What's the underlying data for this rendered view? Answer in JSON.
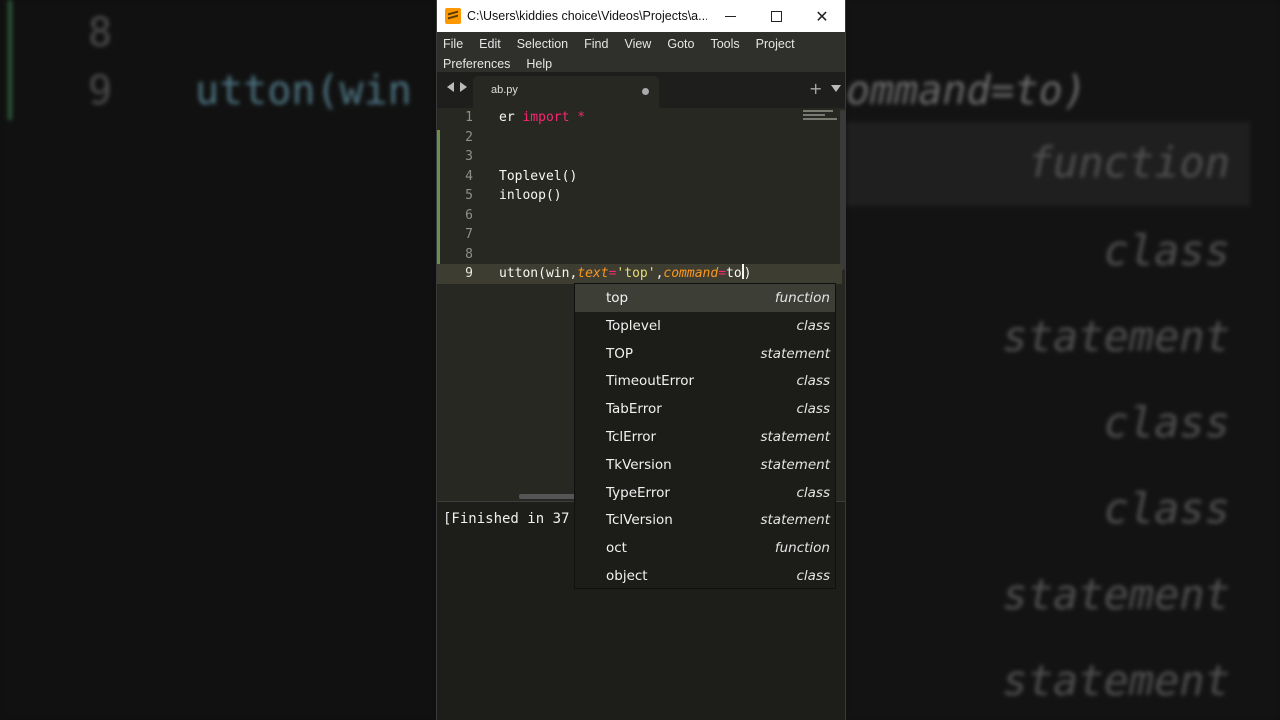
{
  "background": {
    "zoom_line_numbers": [
      "8",
      "9"
    ],
    "zoom_code": "utton(win",
    "zoom_command": "ommand=to)",
    "zoom_kinds": [
      "function",
      "class",
      "statement",
      "class",
      "class",
      "statement",
      "statement"
    ]
  },
  "window": {
    "title": "C:\\Users\\kiddies choice\\Videos\\Projects\\a...",
    "controls": {
      "minimize": "minimize",
      "maximize": "maximize",
      "close": "✕"
    }
  },
  "menu": {
    "row1": [
      "File",
      "Edit",
      "Selection",
      "Find",
      "View",
      "Goto",
      "Tools",
      "Project"
    ],
    "row2": [
      "Preferences",
      "Help"
    ]
  },
  "tab": {
    "filename": "ab.py",
    "plus": "+"
  },
  "editor": {
    "lines": [
      {
        "number": "1",
        "pre": "er ",
        "kw": "import",
        "post": " *"
      },
      {
        "number": "2",
        "text": ""
      },
      {
        "number": "3",
        "text": ""
      },
      {
        "number": "4",
        "text": "Toplevel()"
      },
      {
        "number": "5",
        "text": "inloop()"
      },
      {
        "number": "6",
        "text": ""
      },
      {
        "number": "7",
        "text": ""
      },
      {
        "number": "8",
        "text": ""
      },
      {
        "number": "9",
        "pre": "utton(win,",
        "arg1": "text",
        "eq1": "=",
        "str1": "'top'",
        "comma": ",",
        "arg2": "command",
        "eq2": "=",
        "typed": "to",
        "close": ")"
      }
    ],
    "current_line": "9"
  },
  "console": {
    "text": "[Finished in 37"
  },
  "autocomplete": {
    "items": [
      {
        "name": "top",
        "kind": "function",
        "selected": true
      },
      {
        "name": "Toplevel",
        "kind": "class"
      },
      {
        "name": "TOP",
        "kind": "statement"
      },
      {
        "name": "TimeoutError",
        "kind": "class"
      },
      {
        "name": "TabError",
        "kind": "class"
      },
      {
        "name": "TclError",
        "kind": "statement"
      },
      {
        "name": "TkVersion",
        "kind": "statement"
      },
      {
        "name": "TypeError",
        "kind": "class"
      },
      {
        "name": "TclVersion",
        "kind": "statement"
      },
      {
        "name": "oct",
        "kind": "function"
      },
      {
        "name": "object",
        "kind": "class"
      }
    ]
  },
  "colors": {
    "editor_bg": "#272822",
    "keyword": "#f92672",
    "param": "#fd971f",
    "string": "#e6db74",
    "modified_gutter": "#6a8f4f"
  }
}
